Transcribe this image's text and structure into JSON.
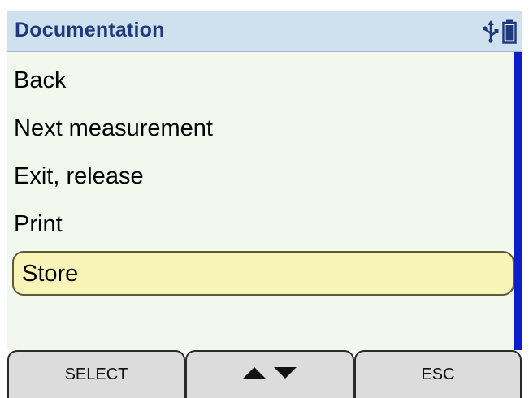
{
  "header": {
    "title": "Documentation",
    "icons": [
      "usb-icon",
      "battery-icon"
    ]
  },
  "menu": {
    "items": [
      {
        "label": "Back",
        "selected": false
      },
      {
        "label": "Next measurement",
        "selected": false
      },
      {
        "label": "Exit, release",
        "selected": false
      },
      {
        "label": "Print",
        "selected": false
      },
      {
        "label": "Store",
        "selected": true
      }
    ]
  },
  "softkeys": {
    "select_label": "SELECT",
    "navigate_icons": [
      "up-arrow-icon",
      "down-arrow-icon"
    ],
    "esc_label": "ESC"
  },
  "colors": {
    "header_bg": "#cfe0ef",
    "title_text": "#1f3a7a",
    "content_bg": "#f3f8ee",
    "selection_bg": "#f8f4b8",
    "scrollbar": "#0b1ec9",
    "softkey_bg": "#dcdcdc"
  }
}
